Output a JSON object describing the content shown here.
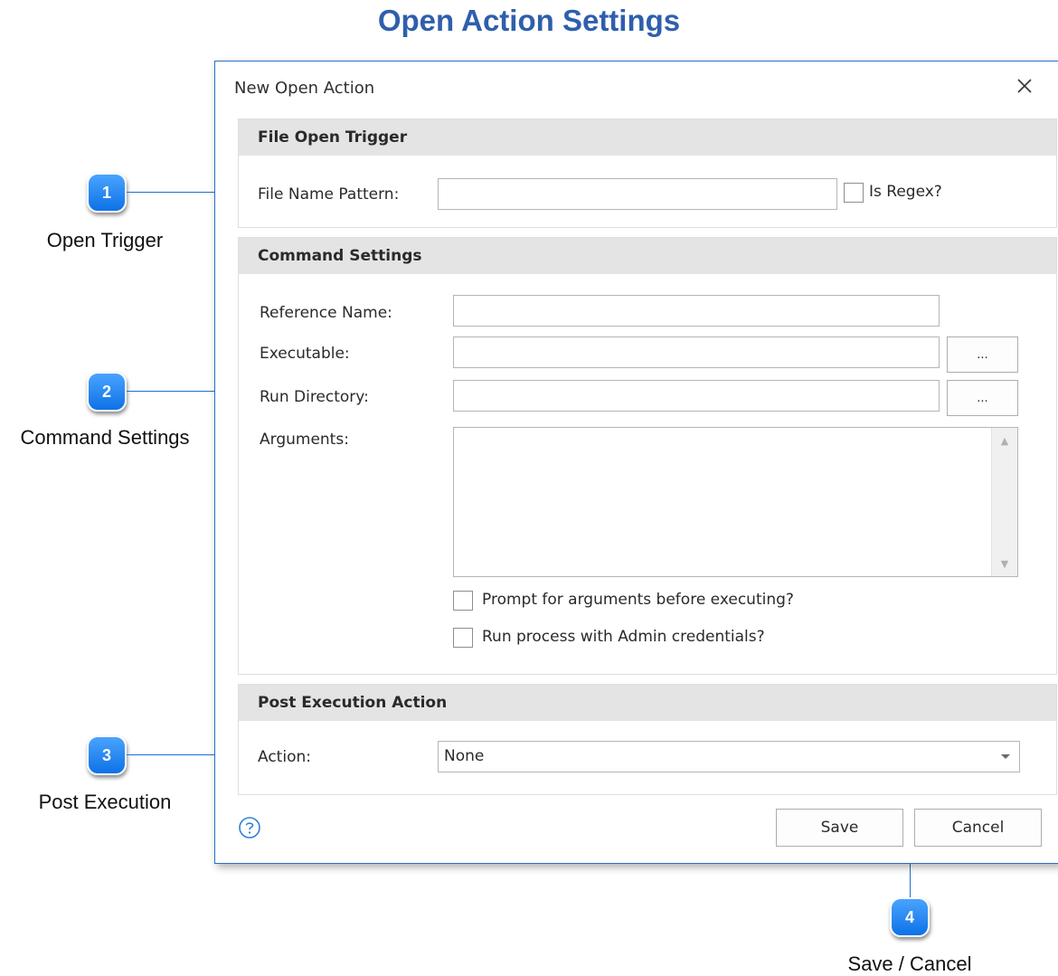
{
  "page_title": "Open Action Settings",
  "callouts": [
    {
      "number": "1",
      "label": "Open Trigger"
    },
    {
      "number": "2",
      "label": "Command Settings"
    },
    {
      "number": "3",
      "label": "Post Execution"
    },
    {
      "number": "4",
      "label": "Save / Cancel"
    }
  ],
  "dialog": {
    "title": "New Open Action",
    "close_icon": "close-icon",
    "sections": {
      "trigger": {
        "header": "File Open Trigger",
        "file_name_pattern_label": "File Name Pattern:",
        "file_name_pattern_value": "",
        "is_regex_label": "Is Regex?"
      },
      "command": {
        "header": "Command Settings",
        "reference_name_label": "Reference Name:",
        "reference_name_value": "",
        "executable_label": "Executable:",
        "executable_value": "",
        "run_directory_label": "Run Directory:",
        "run_directory_value": "",
        "browse_label": "...",
        "arguments_label": "Arguments:",
        "arguments_value": "",
        "prompt_label": "Prompt for arguments before executing?",
        "admin_label": "Run process with Admin credentials?"
      },
      "post": {
        "header": "Post Execution Action",
        "action_label": "Action:",
        "action_value": "None"
      }
    },
    "help_icon": "help-circle-icon",
    "save_label": "Save",
    "cancel_label": "Cancel"
  },
  "colors": {
    "accent": "#2f5fac",
    "badge": "#0d72e6",
    "line": "#1b6fd0"
  }
}
